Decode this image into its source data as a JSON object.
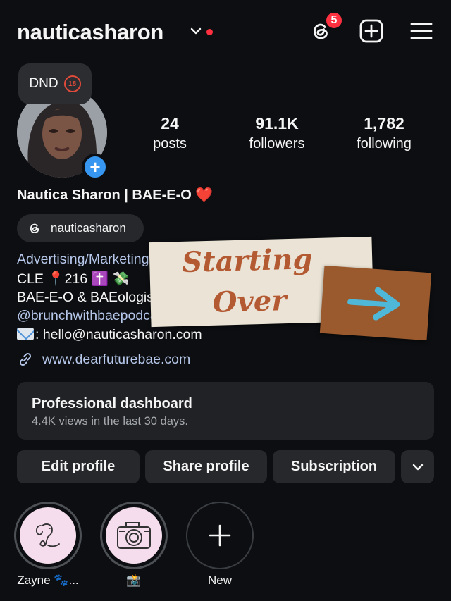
{
  "header": {
    "username": "nauticasharon",
    "threads_badge_count": "5"
  },
  "note": {
    "text": "DND",
    "emoji": "🔞"
  },
  "stats": [
    {
      "value": "24",
      "label": "posts"
    },
    {
      "value": "91.1K",
      "label": "followers"
    },
    {
      "value": "1,782",
      "label": "following"
    }
  ],
  "profile": {
    "full_name": "Nautica Sharon | BAE-E-O ❤️",
    "threads_handle": "nauticasharon",
    "bio_lines": [
      "Advertising/Marketing",
      "CLE 📍216 ✝️ 💸",
      "BAE-E-O & BAEologist",
      "@brunchwithbaepodcast",
      ": hello@nauticasharon.com"
    ],
    "link": "www.dearfuturebae.com"
  },
  "sticker": {
    "line1": "Starting",
    "line2": "Over"
  },
  "dashboard": {
    "title": "Professional dashboard",
    "subtitle": "4.4K views in the last 30 days."
  },
  "buttons": {
    "edit": "Edit profile",
    "share": "Share profile",
    "subscription": "Subscription"
  },
  "highlights": [
    {
      "label": "Zayne 🐾..."
    },
    {
      "label": "📸"
    },
    {
      "label": "New"
    }
  ],
  "colors": {
    "background": "#0c0e11",
    "accent_blue": "#3797f0",
    "notification_red": "#ff3040",
    "link_color": "#b6c7ea",
    "sticker_text": "#b45a33"
  }
}
